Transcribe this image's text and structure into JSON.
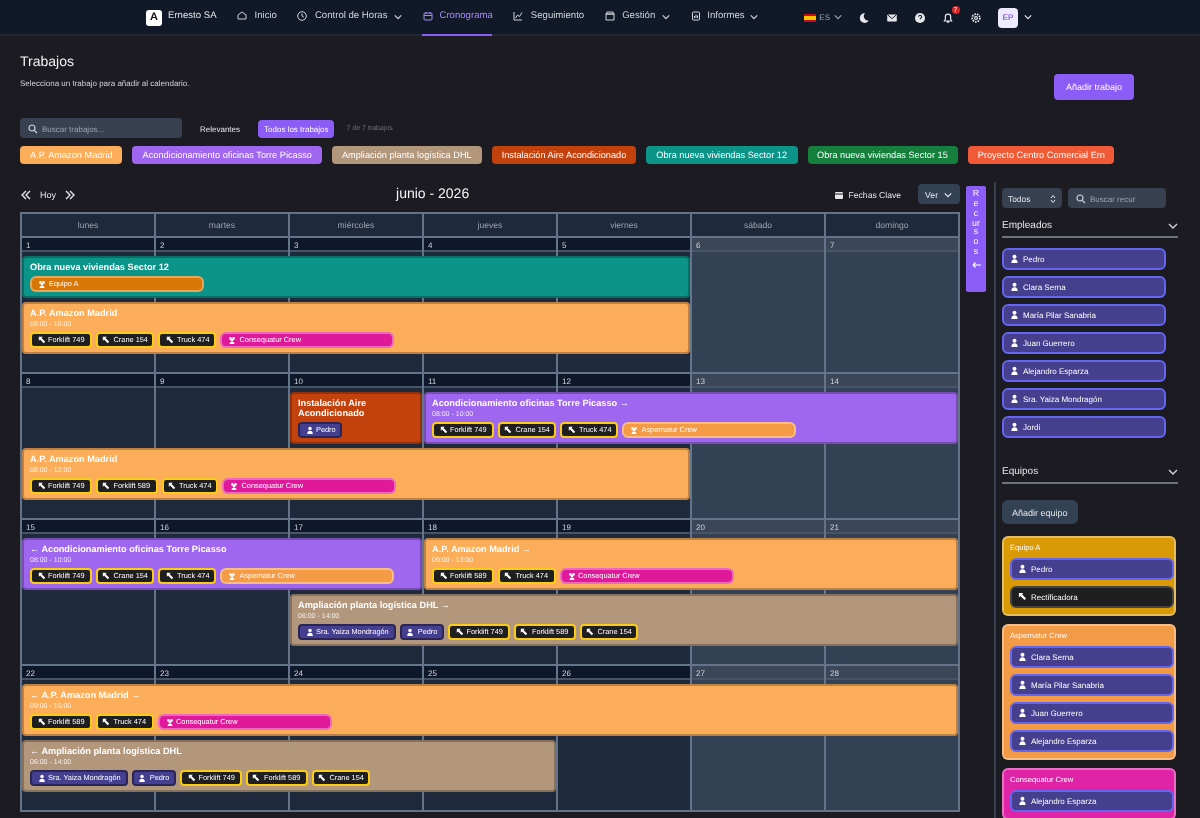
{
  "nav": {
    "logo": "A",
    "brand": "Ernesto SA",
    "items": [
      {
        "label": "Inicio",
        "selected": false,
        "dropdown": false
      },
      {
        "label": "Control de Horas",
        "selected": false,
        "dropdown": true
      },
      {
        "label": "Cronograma",
        "selected": true,
        "dropdown": false
      },
      {
        "label": "Seguimiento",
        "selected": false,
        "dropdown": false
      },
      {
        "label": "Gestión",
        "selected": false,
        "dropdown": true
      },
      {
        "label": "Informes",
        "selected": false,
        "dropdown": true
      }
    ],
    "language": "ES",
    "notifications": "7",
    "avatar": "EP"
  },
  "jobs_panel": {
    "title": "Trabajos",
    "subtitle": "Selecciona un trabajo para añadir al calendario.",
    "add_button": "Añadir trabajo",
    "search": {
      "placeholder": "Buscar trabajos..."
    },
    "filters": [
      {
        "label": "Relevantes",
        "selected": false
      },
      {
        "label": "Todos los trabajos",
        "selected": true
      }
    ],
    "count": "7 de 7 trabajos",
    "jobs": [
      {
        "name": "A.P. Amazon Madrid",
        "color": "#fbad5a"
      },
      {
        "name": "Acondicionamiento oficinas Torre Picasso",
        "color": "#9f67f0"
      },
      {
        "name": "Ampliación planta logística DHL",
        "color": "#b3977c"
      },
      {
        "name": "Instalación Aire Acondicionado",
        "color": "#c2410c"
      },
      {
        "name": "Obra nueva viviendas Sector 12",
        "color": "#0d9488"
      },
      {
        "name": "Obra nueva viviendas Sector 15",
        "color": "#15803d"
      },
      {
        "name": "Proyecto Centro Comercial Ern",
        "color": "#f05a36"
      }
    ]
  },
  "calendar": {
    "today": "Hoy",
    "title": "junio - 2026",
    "key_dates": "Fechas Clave",
    "view": "Ver",
    "weekdays": [
      "lunes",
      "martes",
      "miércoles",
      "jueves",
      "viernes",
      "sábado",
      "domingo"
    ],
    "weeks": [
      {
        "days": [
          {
            "day": "1",
            "weekend": false
          },
          {
            "day": "2",
            "weekend": false
          },
          {
            "day": "3",
            "weekend": false
          },
          {
            "day": "4",
            "weekend": false
          },
          {
            "day": "5",
            "weekend": false
          },
          {
            "day": "6",
            "weekend": true
          },
          {
            "day": "7",
            "weekend": true
          }
        ],
        "lanes": [
          [
            {
              "title": "Obra nueva viviendas Sector 12",
              "color": "#0d9488",
              "covers": [
                true,
                true,
                true,
                true,
                true,
                false,
                false
              ],
              "chips": [
                {
                  "kind": "team",
                  "label": "Equipo A",
                  "color": "#d97706"
                }
              ]
            }
          ],
          [
            {
              "title": "A.P. Amazon Madrid",
              "time": "08:00 - 16:00",
              "color": "#fbad5a",
              "covers": [
                true,
                true,
                true,
                true,
                true,
                false,
                false
              ],
              "chips": [
                {
                  "kind": "machine",
                  "label": "Forklift 749"
                },
                {
                  "kind": "machine",
                  "label": "Crane 154"
                },
                {
                  "kind": "machine",
                  "label": "Truck 474"
                },
                {
                  "kind": "team",
                  "label": "Consequatur Crew",
                  "color": "#e0199b"
                }
              ]
            }
          ]
        ]
      },
      {
        "days": [
          {
            "day": "8",
            "weekend": false
          },
          {
            "day": "9",
            "weekend": false
          },
          {
            "day": "10",
            "weekend": false
          },
          {
            "day": "11",
            "weekend": false
          },
          {
            "day": "12",
            "weekend": false
          },
          {
            "day": "13",
            "weekend": true
          },
          {
            "day": "14",
            "weekend": true
          }
        ],
        "lanes": [
          [
            {
              "title": "Instalación Aire Acondicionado",
              "color": "#c2410c",
              "covers": [
                false,
                false,
                true,
                false,
                false,
                false,
                false
              ],
              "chips": [
                {
                  "kind": "person",
                  "label": "Pedro"
                }
              ]
            },
            {
              "title": "Acondicionamiento oficinas Torre Picasso →",
              "time": "08:00 - 10:00",
              "color": "#9f67f0",
              "covers": [
                false,
                false,
                false,
                true,
                true,
                true,
                true
              ],
              "chips": [
                {
                  "kind": "machine",
                  "label": "Forklift 749"
                },
                {
                  "kind": "machine",
                  "label": "Crane 154"
                },
                {
                  "kind": "machine",
                  "label": "Truck 474"
                },
                {
                  "kind": "team",
                  "label": "Aspernatur Crew",
                  "color": "#f59a45"
                }
              ]
            }
          ],
          [
            {
              "title": "A.P. Amazon Madrid",
              "time": "08:00 - 12:00",
              "color": "#fbad5a",
              "covers": [
                true,
                true,
                true,
                true,
                true,
                false,
                false
              ],
              "chips": [
                {
                  "kind": "machine",
                  "label": "Forklift 749"
                },
                {
                  "kind": "machine",
                  "label": "Forklift 589"
                },
                {
                  "kind": "machine",
                  "label": "Truck 474"
                },
                {
                  "kind": "team",
                  "label": "Consequatur Crew",
                  "color": "#e0199b"
                }
              ]
            }
          ]
        ]
      },
      {
        "days": [
          {
            "day": "15",
            "weekend": false
          },
          {
            "day": "16",
            "weekend": false
          },
          {
            "day": "17",
            "weekend": false
          },
          {
            "day": "18",
            "weekend": false
          },
          {
            "day": "19",
            "weekend": false
          },
          {
            "day": "20",
            "weekend": true
          },
          {
            "day": "21",
            "weekend": true
          }
        ],
        "lanes": [
          [
            {
              "title": "← Acondicionamiento oficinas Torre Picasso",
              "time": "08:00 - 10:00",
              "color": "#9f67f0",
              "covers": [
                true,
                true,
                true,
                false,
                false,
                false,
                false
              ],
              "chips": [
                {
                  "kind": "machine",
                  "label": "Forklift 749"
                },
                {
                  "kind": "machine",
                  "label": "Crane 154"
                },
                {
                  "kind": "machine",
                  "label": "Truck 474"
                },
                {
                  "kind": "team",
                  "label": "Aspernatur Crew",
                  "color": "#f59a45"
                }
              ]
            },
            {
              "title": "A.P. Amazon Madrid →",
              "time": "09:00 - 13:00",
              "color": "#fbad5a",
              "covers": [
                false,
                false,
                false,
                true,
                true,
                true,
                true
              ],
              "chips": [
                {
                  "kind": "machine",
                  "label": "Forklift 589"
                },
                {
                  "kind": "machine",
                  "label": "Truck 474"
                },
                {
                  "kind": "team",
                  "label": "Consequatur Crew",
                  "color": "#e0199b"
                }
              ]
            }
          ],
          [
            {
              "title": "Ampliación planta logística DHL →",
              "time": "06:00 - 14:00",
              "color": "#b3977c",
              "covers": [
                false,
                false,
                true,
                true,
                true,
                true,
                true
              ],
              "chips": [
                {
                  "kind": "person",
                  "label": "Sra. Yaiza Mondragón"
                },
                {
                  "kind": "person",
                  "label": "Pedro"
                },
                {
                  "kind": "machine",
                  "label": "Forklift 749"
                },
                {
                  "kind": "machine",
                  "label": "Forklift 589"
                },
                {
                  "kind": "machine",
                  "label": "Crane 154"
                }
              ]
            }
          ]
        ]
      },
      {
        "days": [
          {
            "day": "22",
            "weekend": false
          },
          {
            "day": "23",
            "weekend": false
          },
          {
            "day": "24",
            "weekend": false
          },
          {
            "day": "25",
            "weekend": false
          },
          {
            "day": "26",
            "weekend": false
          },
          {
            "day": "27",
            "weekend": true
          },
          {
            "day": "28",
            "weekend": true
          }
        ],
        "lanes": [
          [
            {
              "title": "← A.P. Amazon Madrid →",
              "time": "09:00 - 15:00",
              "color": "#fbad5a",
              "covers": [
                true,
                true,
                true,
                true,
                true,
                true,
                true
              ],
              "chips": [
                {
                  "kind": "machine",
                  "label": "Forklift 589"
                },
                {
                  "kind": "machine",
                  "label": "Truck 474"
                },
                {
                  "kind": "team",
                  "label": "Consequatur Crew",
                  "color": "#e0199b"
                }
              ]
            }
          ],
          [
            {
              "title": "← Ampliación planta logística DHL",
              "time": "06:00 - 14:00",
              "color": "#b3977c",
              "covers": [
                true,
                true,
                true,
                true,
                false,
                false,
                false
              ],
              "chips": [
                {
                  "kind": "person",
                  "label": "Sra. Yaiza Mondragón"
                },
                {
                  "kind": "person",
                  "label": "Pedro"
                },
                {
                  "kind": "machine",
                  "label": "Forklift 749"
                },
                {
                  "kind": "machine",
                  "label": "Forklift 589"
                },
                {
                  "kind": "machine",
                  "label": "Crane 154"
                }
              ]
            }
          ]
        ]
      }
    ]
  },
  "resources_tab": "Recursos",
  "resources": {
    "filter": "Todos",
    "search": {
      "placeholder": "Buscar recur"
    },
    "employees": {
      "title": "Empleados",
      "expanded": true,
      "items": [
        "Pedro",
        "Clara Serna",
        "María Pilar Sanabria",
        "Juan Guerrero",
        "Alejandro Esparza",
        "Sra. Yaiza Mondragón",
        "Jordi"
      ]
    },
    "teams": {
      "title": "Equipos",
      "expanded": true,
      "add_button": "Añadir equipo",
      "items": [
        {
          "name": "Equipo A",
          "color": "#d99a06",
          "members": [
            {
              "kind": "person",
              "label": "Pedro"
            },
            {
              "kind": "machine",
              "label": "Rectificadora"
            }
          ]
        },
        {
          "name": "Aspernatur Crew",
          "color": "#f29a45",
          "members": [
            {
              "kind": "person",
              "label": "Clara Serna"
            },
            {
              "kind": "person",
              "label": "María Pilar Sanabria"
            },
            {
              "kind": "person",
              "label": "Juan Guerrero"
            },
            {
              "kind": "person",
              "label": "Alejandro Esparza"
            }
          ]
        },
        {
          "name": "Consequatur Crew",
          "color": "#e024a7",
          "members": [
            {
              "kind": "person",
              "label": "Alejandro Esparza"
            }
          ]
        }
      ]
    }
  }
}
